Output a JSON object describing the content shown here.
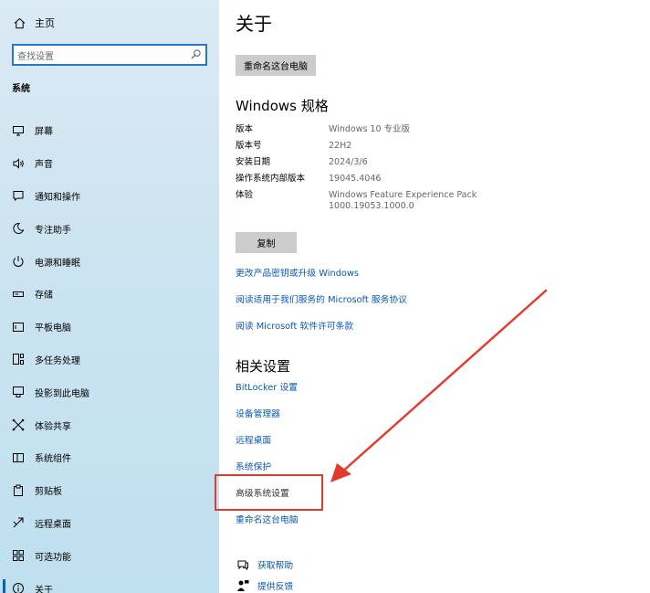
{
  "sidebar": {
    "home_label": "主页",
    "search_placeholder": "查找设置",
    "section_title": "系统",
    "items": [
      {
        "label": "屏幕",
        "icon": "monitor-icon"
      },
      {
        "label": "声音",
        "icon": "speaker-icon"
      },
      {
        "label": "通知和操作",
        "icon": "notification-icon"
      },
      {
        "label": "专注助手",
        "icon": "moon-icon"
      },
      {
        "label": "电源和睡眠",
        "icon": "power-icon"
      },
      {
        "label": "存储",
        "icon": "storage-icon"
      },
      {
        "label": "平板电脑",
        "icon": "tablet-icon"
      },
      {
        "label": "多任务处理",
        "icon": "multitask-icon"
      },
      {
        "label": "投影到此电脑",
        "icon": "project-icon"
      },
      {
        "label": "体验共享",
        "icon": "share-icon"
      },
      {
        "label": "系统组件",
        "icon": "components-icon"
      },
      {
        "label": "剪贴板",
        "icon": "clipboard-icon"
      },
      {
        "label": "远程桌面",
        "icon": "remote-icon"
      },
      {
        "label": "可选功能",
        "icon": "features-icon"
      },
      {
        "label": "关于",
        "icon": "info-icon",
        "selected": true
      }
    ]
  },
  "main": {
    "title": "关于",
    "rename_button": "重命名这台电脑",
    "specs_heading": "Windows 规格",
    "specs": [
      {
        "key": "版本",
        "value": "Windows 10 专业版"
      },
      {
        "key": "版本号",
        "value": "22H2"
      },
      {
        "key": "安装日期",
        "value": "2024/3/6"
      },
      {
        "key": "操作系统内部版本",
        "value": "19045.4046"
      },
      {
        "key": "体验",
        "value": "Windows Feature Experience Pack\n1000.19053.1000.0"
      }
    ],
    "copy_button": "复制",
    "links": [
      "更改产品密钥或升级 Windows",
      "阅读适用于我们服务的 Microsoft 服务协议",
      "阅读 Microsoft 软件许可条款"
    ],
    "related_heading": "相关设置",
    "related_links": [
      "BitLocker 设置",
      "设备管理器",
      "远程桌面",
      "系统保护",
      "高级系统设置",
      "重命名这台电脑"
    ],
    "help": [
      {
        "label": "获取帮助",
        "icon": "help-chat-icon"
      },
      {
        "label": "提供反馈",
        "icon": "feedback-icon"
      }
    ]
  },
  "colors": {
    "accent": "#0a58b5",
    "annotation": "#e5392e",
    "sidebar": "#cde4f1"
  }
}
